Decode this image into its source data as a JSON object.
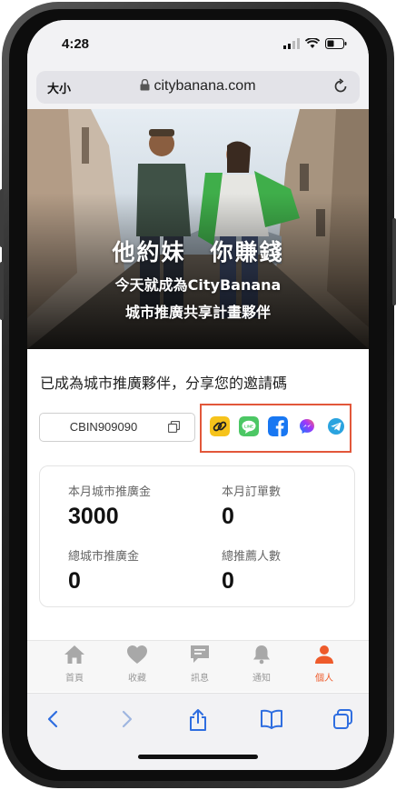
{
  "status_bar": {
    "time": "4:28"
  },
  "browser": {
    "text_size_button": "大小",
    "url": "citybanana.com"
  },
  "hero": {
    "title": "他約妹　你賺錢",
    "subtitle_line1": "今天就成為CityBanana",
    "subtitle_line2": "城市推廣共享計畫夥伴"
  },
  "share": {
    "heading": "已成為城市推廣夥伴，分享您的邀請碼",
    "invite_code": "CBIN909090",
    "icons": [
      "link-icon",
      "line-icon",
      "facebook-icon",
      "messenger-icon",
      "telegram-icon"
    ],
    "highlight_color": "#e2573a"
  },
  "stats": {
    "monthly_promo_label": "本月城市推廣金",
    "monthly_promo_value": "3000",
    "monthly_orders_label": "本月訂單數",
    "monthly_orders_value": "0",
    "total_promo_label": "總城市推廣金",
    "total_promo_value": "0",
    "total_referrals_label": "總推薦人數",
    "total_referrals_value": "0"
  },
  "tabbar": {
    "items": [
      {
        "label": "首頁",
        "icon": "home-icon"
      },
      {
        "label": "收藏",
        "icon": "heart-icon"
      },
      {
        "label": "訊息",
        "icon": "chat-icon"
      },
      {
        "label": "通知",
        "icon": "bell-icon"
      },
      {
        "label": "個人",
        "icon": "person-icon",
        "active": true
      }
    ],
    "active_color": "#ee5b2b"
  }
}
